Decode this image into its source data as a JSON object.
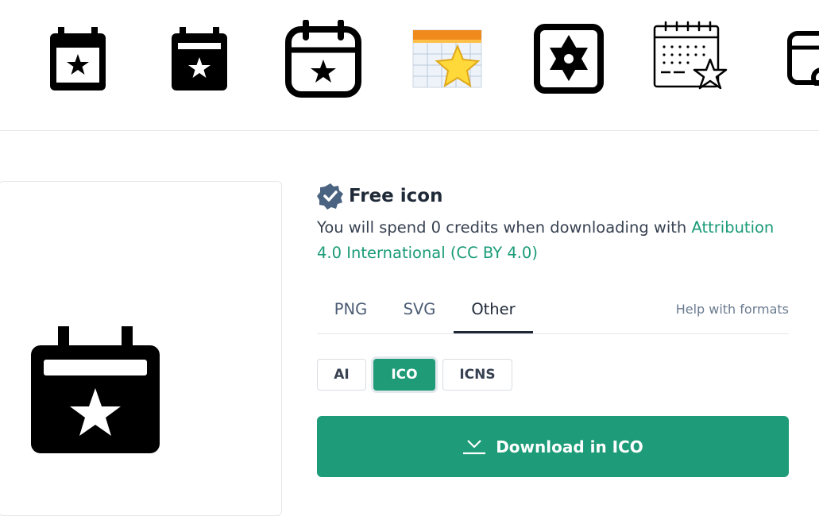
{
  "related_icons": [
    {
      "name": "calendar-star-outline"
    },
    {
      "name": "calendar-star-solid"
    },
    {
      "name": "calendar-star-rounded"
    },
    {
      "name": "calendar-star-color"
    },
    {
      "name": "calendar-star-of-david"
    },
    {
      "name": "calendar-dots-star"
    },
    {
      "name": "calendar-partial"
    }
  ],
  "preview": {
    "icon": "calendar-star-solid-icon"
  },
  "details": {
    "title": "Free icon",
    "credits_text": "You will spend 0 credits when downloading with ",
    "license": "Attribution 4.0 International (CC BY 4.0)",
    "tabs": [
      "PNG",
      "SVG",
      "Other"
    ],
    "active_tab": "Other",
    "help_link": "Help with formats",
    "formats": [
      "AI",
      "ICO",
      "ICNS"
    ],
    "selected_format": "ICO",
    "download_label": "Download in ICO"
  },
  "colors": {
    "accent": "#1e9b78",
    "badge": "#4a6380",
    "text": "#1f2937"
  }
}
